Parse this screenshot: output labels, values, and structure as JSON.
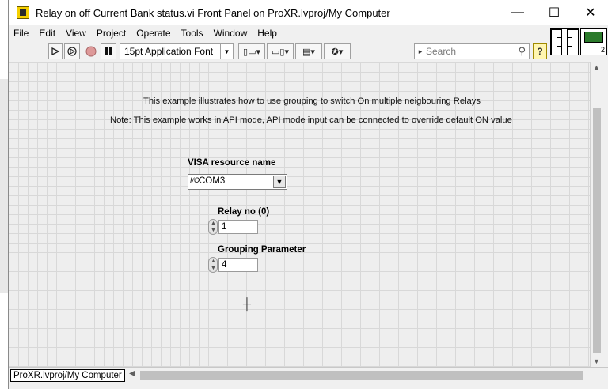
{
  "window": {
    "title": "Relay on off Current Bank status.vi Front Panel on ProXR.lvproj/My Computer",
    "minimize": "—",
    "maximize": "☐",
    "close": "✕"
  },
  "menu": [
    "File",
    "Edit",
    "View",
    "Project",
    "Operate",
    "Tools",
    "Window",
    "Help"
  ],
  "toolbar": {
    "font": "15pt Application Font",
    "search_placeholder": "Search",
    "help": "?"
  },
  "panel": {
    "note1": "This example illustrates how to use grouping to switch On multiple neigbouring Relays",
    "note2": "Note: This example works in API mode, API mode input can be connected to override default ON value",
    "visa_label": "VISA resource name",
    "visa_value": "COM3",
    "relay_label": "Relay no (0)",
    "relay_value": "1",
    "grouping_label": "Grouping Parameter",
    "grouping_value": "4"
  },
  "status": {
    "context": "ProXR.lvproj/My Computer"
  },
  "icon": {
    "connector_count": "2"
  }
}
